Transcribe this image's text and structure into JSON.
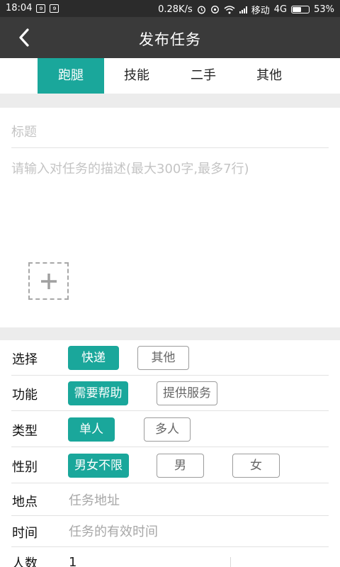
{
  "status_bar": {
    "time": "18:04",
    "notif_icons": [
      "ɘ",
      "ɘ"
    ],
    "net_speed": "0.28K/s",
    "carrier": "移动",
    "network": "4G",
    "battery_text": "53%",
    "battery_level": 0.53
  },
  "navbar": {
    "title": "发布任务",
    "back_icon": "chevron-left-icon"
  },
  "tabs": [
    {
      "label": "跑腿",
      "active": true
    },
    {
      "label": "技能",
      "active": false
    },
    {
      "label": "二手",
      "active": false
    },
    {
      "label": "其他",
      "active": false
    }
  ],
  "form": {
    "title_placeholder": "标题",
    "desc_placeholder": "请输入对任务的描述(最大300字,最多7行)",
    "add_image_icon": "plus-icon"
  },
  "rows": {
    "select": {
      "label": "选择",
      "options": [
        "快递",
        "其他"
      ],
      "selected": "快递"
    },
    "function": {
      "label": "功能",
      "options": [
        "需要帮助",
        "提供服务"
      ],
      "selected": "需要帮助"
    },
    "type": {
      "label": "类型",
      "options": [
        "单人",
        "多人"
      ],
      "selected": "单人"
    },
    "gender": {
      "label": "性别",
      "options": [
        "男女不限",
        "男",
        "女"
      ],
      "selected": "男女不限"
    },
    "location": {
      "label": "地点",
      "placeholder": "任务地址"
    },
    "time": {
      "label": "时间",
      "placeholder": "任务的有效时间"
    },
    "count": {
      "label": "人数",
      "value": "1"
    }
  },
  "colors": {
    "accent": "#1aa79b",
    "navbar": "#3a3a3a",
    "statusbar": "#2b2b2b",
    "separator": "#ececec"
  }
}
